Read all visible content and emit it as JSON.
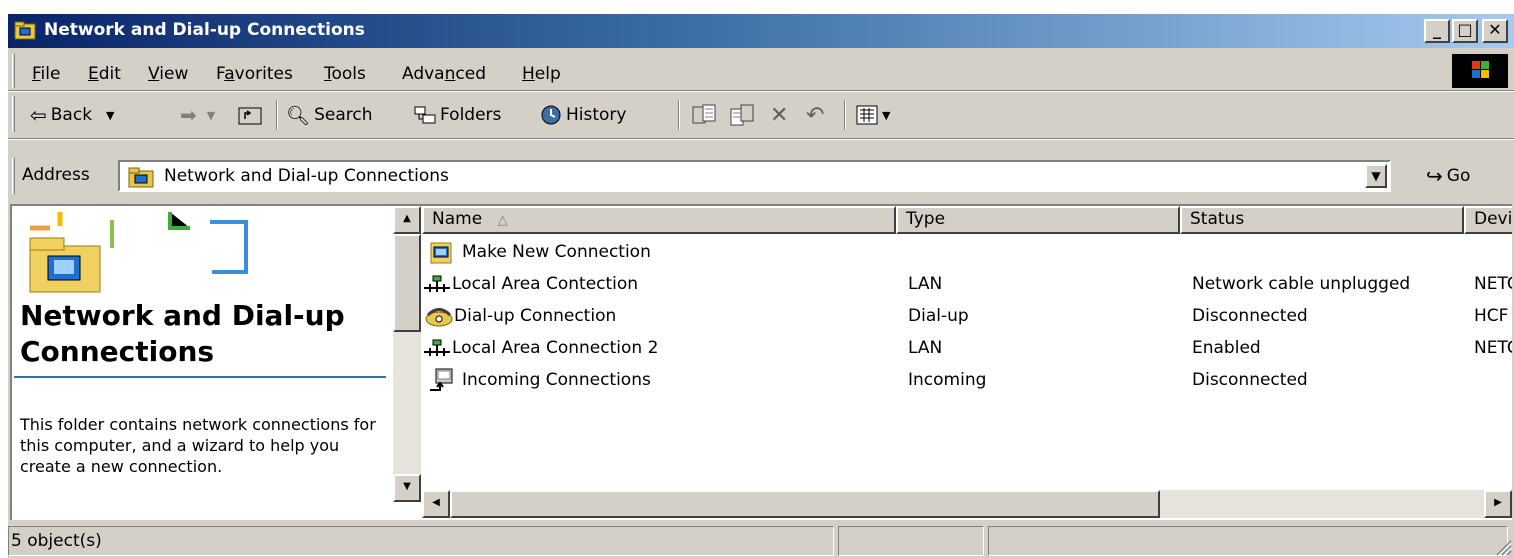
{
  "window": {
    "title": "Network and Dial-up Connections",
    "icon": "network-folder-icon",
    "controls": {
      "minimize": "_",
      "maximize": "□",
      "close": "✕"
    }
  },
  "menubar": {
    "items": [
      "File",
      "Edit",
      "View",
      "Favorites",
      "Tools",
      "Advanced",
      "Help"
    ],
    "access_keys": [
      "F",
      "E",
      "V",
      "a",
      "T",
      "n",
      "H"
    ]
  },
  "toolbar": {
    "back_label": "Back",
    "search_label": "Search",
    "folders_label": "Folders",
    "history_label": "History",
    "icons": [
      "back-arrow-icon",
      "forward-arrow-icon",
      "up-folder-icon",
      "search-icon",
      "folders-icon",
      "history-icon",
      "move-to-icon",
      "copy-to-icon",
      "delete-icon",
      "undo-icon",
      "views-icon"
    ]
  },
  "address": {
    "label": "Address",
    "value": "Network and Dial-up Connections",
    "go_label": "Go"
  },
  "left_pane": {
    "title": "Network and Dial-up Connections",
    "description": "This folder contains network connections for this computer, and a wizard to help you create a new connection."
  },
  "list": {
    "columns": [
      "Name",
      "Type",
      "Status",
      "Devi"
    ],
    "sort_column": "Name",
    "sort_indicator": "△",
    "rows": [
      {
        "name": "Make New Connection",
        "type": "",
        "status": "",
        "device": "",
        "icon": "make-new-connection-icon"
      },
      {
        "name": "Local Area Contection",
        "type": "LAN",
        "status": "Network cable unplugged",
        "device": "NETC",
        "icon": "lan-icon"
      },
      {
        "name": "Dial-up Connection",
        "type": "Dial-up",
        "status": "Disconnected",
        "device": "HCF",
        "icon": "dialup-icon"
      },
      {
        "name": "Local Area Connection 2",
        "type": "LAN",
        "status": "Enabled",
        "device": "NETC",
        "icon": "lan-icon"
      },
      {
        "name": "Incoming Connections",
        "type": "Incoming",
        "status": "Disconnected",
        "device": "",
        "icon": "incoming-connections-icon"
      }
    ]
  },
  "statusbar": {
    "object_count": "5 object(s)"
  },
  "colors": {
    "title_start": "#0a246a",
    "title_end": "#a6caf0",
    "face": "#d4d0c8",
    "accent_rule": "#3a6ea5"
  }
}
